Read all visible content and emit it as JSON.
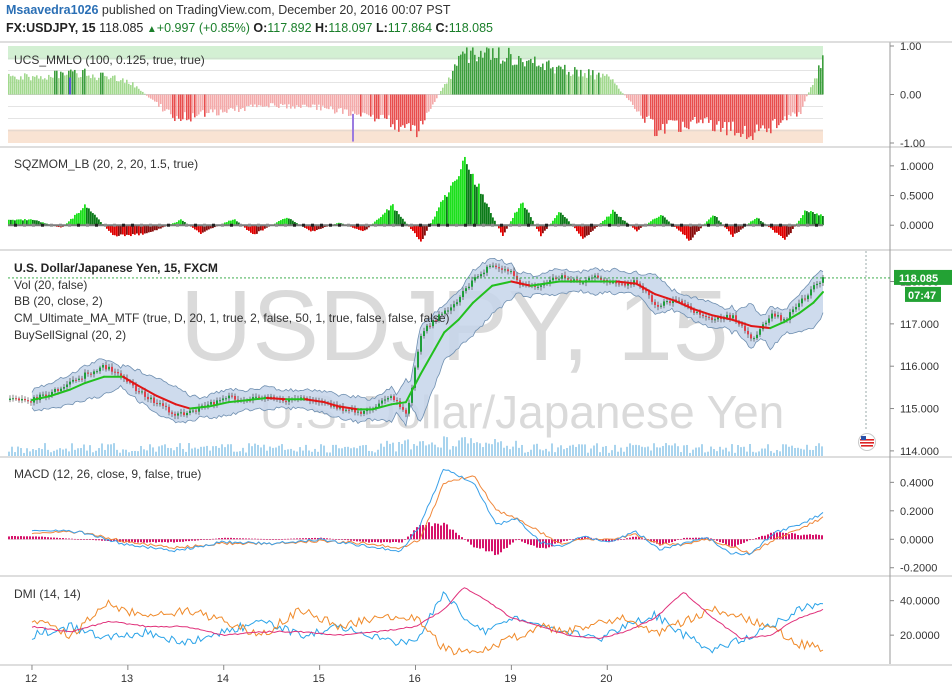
{
  "header": {
    "author": "Msaavedra1026",
    "published": "published on TradingView.com, December 20, 2016 00:07 PST",
    "symbol": "FX:USDJPY, 15",
    "last": "118.085",
    "change": "+0.997 (+0.85%)",
    "open_label": "O:",
    "open": "117.892",
    "high_label": "H:",
    "high": "118.097",
    "low_label": "L:",
    "low": "117.864",
    "close_label": "C:",
    "close": "118.085"
  },
  "colors": {
    "up": "#1f9e3a",
    "down": "#e0404a",
    "bb_fill": "#c6d5ea",
    "bb_line": "#6f8fb0",
    "ma_up": "#22c01e",
    "ma_down": "#e01616",
    "macd": "#3aa0e8",
    "signal": "#f0883c",
    "hist": "#d6136a",
    "dmi_plus": "#2aa3e8",
    "dmi_minus": "#f08a2a",
    "adx": "#e0307a",
    "volume": "#a9d4ee",
    "price_tag": "#23a234"
  },
  "chart_data": [
    {
      "type": "bar",
      "panel": "UCS_MMLO",
      "title": "UCS_MMLO (100, 0.125, true, true)",
      "yticks": [
        "1.00",
        "0.00",
        "-1.00"
      ],
      "ylim": [
        -1.0,
        1.0
      ],
      "segments": [
        {
          "x": 0.0,
          "y": 0.4
        },
        {
          "x": 0.5,
          "y": 0.48
        },
        {
          "x": 1.0,
          "y": 0.3
        },
        {
          "x": 1.5,
          "y": -0.55
        },
        {
          "x": 2.0,
          "y": -0.35
        },
        {
          "x": 2.5,
          "y": -0.25
        },
        {
          "x": 3.0,
          "y": -0.3
        },
        {
          "x": 3.5,
          "y": -0.45
        },
        {
          "x": 4.0,
          "y": -0.8
        },
        {
          "x": 4.5,
          "y": 0.9
        },
        {
          "x": 5.0,
          "y": 0.85
        },
        {
          "x": 5.5,
          "y": 0.55
        },
        {
          "x": 6.0,
          "y": 0.4
        },
        {
          "x": 6.5,
          "y": -0.8
        },
        {
          "x": 7.0,
          "y": -0.6
        },
        {
          "x": 7.5,
          "y": -0.9
        },
        {
          "x": 8.0,
          "y": -0.4
        },
        {
          "x": 8.25,
          "y": 0.8
        }
      ]
    },
    {
      "type": "bar",
      "panel": "SQZMOM_LB",
      "title": "SQZMOM_LB (20, 2, 20, 1.5, true)",
      "yticks": [
        "1.0000",
        "0.5000",
        "0.0000"
      ],
      "ylim": [
        -0.35,
        1.25
      ],
      "segments": [
        {
          "x": 0.0,
          "y": 0.1
        },
        {
          "x": 0.3,
          "y": -0.05
        },
        {
          "x": 0.55,
          "y": 0.35
        },
        {
          "x": 0.85,
          "y": -0.2
        },
        {
          "x": 1.2,
          "y": -0.15
        },
        {
          "x": 1.55,
          "y": 0.1
        },
        {
          "x": 1.75,
          "y": -0.15
        },
        {
          "x": 2.1,
          "y": 0.12
        },
        {
          "x": 2.3,
          "y": -0.18
        },
        {
          "x": 2.65,
          "y": 0.15
        },
        {
          "x": 2.9,
          "y": -0.12
        },
        {
          "x": 3.2,
          "y": 0.05
        },
        {
          "x": 3.45,
          "y": -0.12
        },
        {
          "x": 3.75,
          "y": 0.35
        },
        {
          "x": 4.05,
          "y": -0.3
        },
        {
          "x": 4.5,
          "y": 1.2
        },
        {
          "x": 4.9,
          "y": -0.2
        },
        {
          "x": 5.1,
          "y": 0.45
        },
        {
          "x": 5.3,
          "y": -0.2
        },
        {
          "x": 5.5,
          "y": 0.25
        },
        {
          "x": 5.75,
          "y": -0.25
        },
        {
          "x": 6.05,
          "y": 0.25
        },
        {
          "x": 6.3,
          "y": -0.1
        },
        {
          "x": 6.55,
          "y": 0.2
        },
        {
          "x": 6.85,
          "y": -0.28
        },
        {
          "x": 7.1,
          "y": 0.2
        },
        {
          "x": 7.3,
          "y": -0.2
        },
        {
          "x": 7.55,
          "y": 0.15
        },
        {
          "x": 7.85,
          "y": -0.28
        },
        {
          "x": 8.05,
          "y": 0.25
        },
        {
          "x": 8.25,
          "y": 0.18
        }
      ]
    },
    {
      "type": "line",
      "panel": "price",
      "title": "U.S. Dollar/Japanese Yen, 15, FXCM",
      "indicators": [
        "Vol (20, false)",
        "BB (20, close, 2)",
        "CM_Ultimate_MA_MTF (true, D, 20, 1, true, 2, false, 50, 1, true, false, false, false)",
        "BuySellSignal (20, 2)"
      ],
      "watermark_symbol": "USDJPY, 15",
      "watermark_name": "U.S. Dollar/Japanese Yen",
      "yticks": [
        "118.000",
        "117.000",
        "116.000",
        "115.000",
        "114.000"
      ],
      "ylim": [
        113.95,
        118.65
      ],
      "last_price": "118.085",
      "countdown": "07:47",
      "x": [
        0.0,
        0.2,
        0.4,
        0.55,
        0.75,
        0.95,
        1.1,
        1.3,
        1.5,
        1.65,
        1.85,
        2.05,
        2.25,
        2.45,
        2.65,
        2.85,
        3.05,
        3.2,
        3.4,
        3.55,
        3.75,
        3.9,
        4.05,
        4.2,
        4.3,
        4.45,
        4.6,
        4.8,
        5.0,
        5.1,
        5.2,
        5.35,
        5.5,
        5.7,
        5.9,
        6.1,
        6.3,
        6.5,
        6.7,
        6.9,
        7.1,
        7.3,
        7.5,
        7.7,
        7.85,
        8.0,
        8.15,
        8.25
      ],
      "close": [
        115.2,
        115.4,
        115.6,
        115.8,
        116.0,
        115.7,
        115.4,
        115.1,
        114.85,
        114.9,
        115.1,
        115.25,
        115.2,
        115.3,
        115.2,
        115.25,
        115.1,
        115.0,
        114.9,
        115.0,
        115.3,
        114.8,
        116.8,
        117.1,
        117.3,
        117.6,
        118.1,
        118.4,
        118.2,
        117.9,
        117.85,
        118.0,
        118.1,
        118.0,
        118.1,
        117.9,
        118.0,
        117.4,
        117.6,
        117.3,
        117.1,
        117.2,
        116.6,
        117.2,
        117.1,
        117.5,
        117.9,
        118.085
      ],
      "ma": [
        115.2,
        115.3,
        115.45,
        115.6,
        115.75,
        115.75,
        115.55,
        115.3,
        115.1,
        115.0,
        115.05,
        115.15,
        115.2,
        115.25,
        115.22,
        115.22,
        115.15,
        115.05,
        114.98,
        114.98,
        115.1,
        115.15,
        115.8,
        116.4,
        116.8,
        117.1,
        117.5,
        117.9,
        118.0,
        117.95,
        117.9,
        117.95,
        118.0,
        118.0,
        118.0,
        118.0,
        117.95,
        117.7,
        117.55,
        117.35,
        117.2,
        117.1,
        116.95,
        116.9,
        117.05,
        117.25,
        117.5,
        117.75
      ]
    },
    {
      "type": "line",
      "panel": "MACD",
      "title": "MACD (12, 26, close, 9, false, true)",
      "yticks": [
        "0.4000",
        "0.2000",
        "0.0000",
        "-0.2000"
      ],
      "ylim": [
        -0.23,
        0.55
      ],
      "x": [
        0.0,
        0.5,
        1.0,
        1.5,
        2.0,
        2.5,
        3.0,
        3.5,
        3.85,
        4.05,
        4.3,
        4.6,
        4.85,
        5.05,
        5.3,
        5.5,
        5.75,
        6.0,
        6.3,
        6.55,
        6.8,
        7.05,
        7.3,
        7.5,
        7.75,
        8.0,
        8.25
      ],
      "series": [
        {
          "values": [
            0.07,
            0.05,
            -0.04,
            -0.08,
            -0.02,
            -0.03,
            0.0,
            -0.05,
            -0.08,
            0.1,
            0.5,
            0.4,
            0.1,
            0.15,
            -0.02,
            -0.05,
            0.02,
            -0.02,
            0.05,
            -0.07,
            -0.03,
            0.01,
            -0.1,
            -0.1,
            0.05,
            0.1,
            0.18
          ]
        },
        {
          "values": [
            0.05,
            0.05,
            -0.02,
            -0.06,
            -0.03,
            -0.03,
            -0.01,
            -0.03,
            -0.06,
            0.0,
            0.4,
            0.45,
            0.2,
            0.15,
            0.05,
            -0.03,
            0.0,
            0.0,
            0.03,
            -0.03,
            -0.04,
            0.0,
            -0.05,
            -0.1,
            0.0,
            0.07,
            0.15
          ]
        }
      ]
    },
    {
      "type": "line",
      "panel": "DMI",
      "title": "DMI (14, 14)",
      "yticks": [
        "40.0000",
        "20.0000"
      ],
      "ylim": [
        5,
        52
      ],
      "x": [
        0.0,
        0.4,
        0.8,
        1.2,
        1.6,
        2.0,
        2.4,
        2.8,
        3.2,
        3.6,
        4.0,
        4.3,
        4.5,
        4.75,
        5.0,
        5.3,
        5.6,
        5.9,
        6.2,
        6.5,
        6.8,
        7.1,
        7.4,
        7.7,
        8.0,
        8.25
      ],
      "series": [
        {
          "values": [
            20,
            25,
            18,
            22,
            15,
            22,
            28,
            20,
            25,
            18,
            15,
            45,
            30,
            22,
            30,
            25,
            22,
            18,
            25,
            32,
            20,
            12,
            18,
            25,
            35,
            38
          ]
        },
        {
          "values": [
            30,
            20,
            38,
            30,
            35,
            28,
            20,
            35,
            25,
            30,
            30,
            12,
            10,
            12,
            18,
            25,
            22,
            28,
            30,
            20,
            28,
            35,
            30,
            25,
            15,
            12
          ]
        },
        {
          "values": [
            25,
            22,
            28,
            25,
            25,
            20,
            22,
            22,
            20,
            22,
            25,
            35,
            48,
            40,
            30,
            25,
            20,
            18,
            22,
            30,
            45,
            30,
            18,
            20,
            30,
            35
          ]
        }
      ]
    }
  ],
  "xaxis": {
    "labels": [
      "12",
      "13",
      "14",
      "15",
      "16",
      "19",
      "20"
    ]
  }
}
